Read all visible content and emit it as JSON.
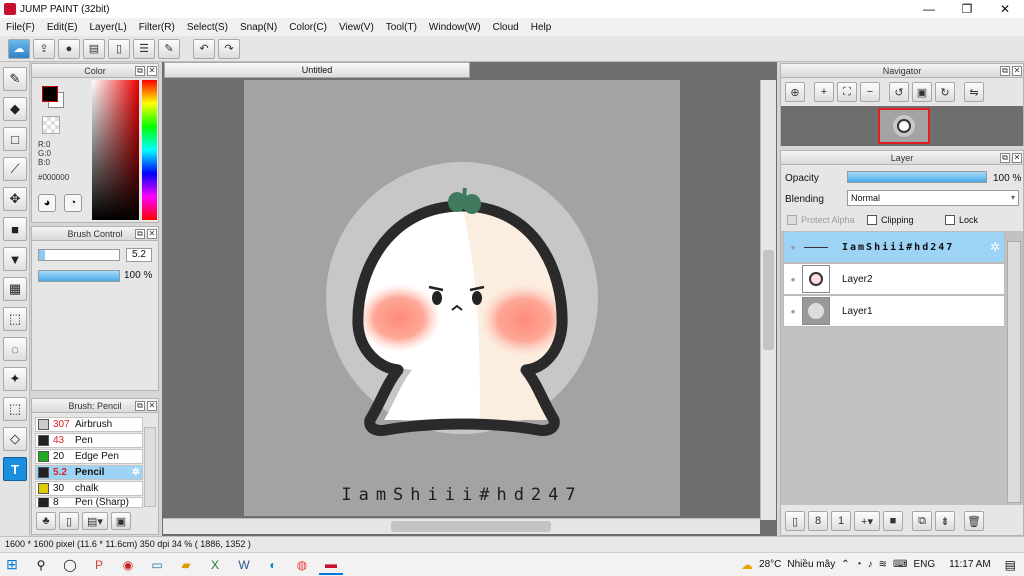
{
  "window": {
    "title": "JUMP PAINT (32bit)",
    "min": "—",
    "max": "❐",
    "close": "✕"
  },
  "menu": [
    "File(F)",
    "Edit(E)",
    "Layer(L)",
    "Filter(R)",
    "Select(S)",
    "Snap(N)",
    "Color(C)",
    "View(V)",
    "Tool(T)",
    "Window(W)",
    "Cloud",
    "Help"
  ],
  "toolbar": {
    "icons": [
      "cloud-icon",
      "export-icon",
      "chat-icon",
      "comment-icon",
      "document-icon",
      "list-icon",
      "edit-list-icon",
      "undo-icon",
      "redo-icon"
    ]
  },
  "tools": [
    "brush",
    "eraser",
    "rectangle",
    "brush-line",
    "move",
    "fill-rect",
    "bucket",
    "gradient",
    "select-rect",
    "select-lasso",
    "magic-wand",
    "select-pen",
    "select-eraser",
    "text"
  ],
  "color": {
    "panel_title": "Color",
    "r": "R:0",
    "g": "G:0",
    "b": "B:0",
    "hex": "#000000",
    "fg": "#000000",
    "bg": "#ffffff"
  },
  "brush_control": {
    "title": "Brush Control",
    "size": "5.2",
    "opacity": "100 %",
    "opacity_level": 1.0
  },
  "brush_list": {
    "title": "Brush: Pencil",
    "items": [
      {
        "size": "307",
        "name": "Airbrush",
        "color": "#cccccc",
        "size_red": true
      },
      {
        "size": "43",
        "name": "Pen",
        "color": "#222222",
        "size_red": true
      },
      {
        "size": "20",
        "name": "Edge Pen",
        "color": "#22aa22",
        "size_red": false
      },
      {
        "size": "5.2",
        "name": "Pencil",
        "color": "#222222",
        "size_red": true,
        "selected": true
      },
      {
        "size": "30",
        "name": "chalk",
        "color": "#ddcc00",
        "size_red": false
      },
      {
        "size": "8",
        "name": "Pen (Sharp)",
        "color": "#222222",
        "size_red": false
      }
    ]
  },
  "document": {
    "tab": "Untitled",
    "text": "IamShiii#hd247"
  },
  "navigator": {
    "title": "Navigator"
  },
  "layer": {
    "title": "Layer",
    "opacity_label": "Opacity",
    "opacity_value": "100 %",
    "opacity_level": 1.0,
    "blending_label": "Blending",
    "blending_value": "Normal",
    "protect_alpha": "Protect Alpha",
    "clipping": "Clipping",
    "lock": "Lock",
    "layers": [
      {
        "name": "IamShiii#hd247",
        "selected": true
      },
      {
        "name": "Layer2",
        "selected": false
      },
      {
        "name": "Layer1",
        "selected": false
      }
    ]
  },
  "status": {
    "text": "1600 * 1600 pixel   (11.6 * 11.6cm)   350 dpi   34 %   ( 1886, 1352 )"
  },
  "taskbar": {
    "weather": "28°C",
    "weather_text": "Nhiều mây",
    "lang": "ENG",
    "time": "11:17 AM"
  }
}
